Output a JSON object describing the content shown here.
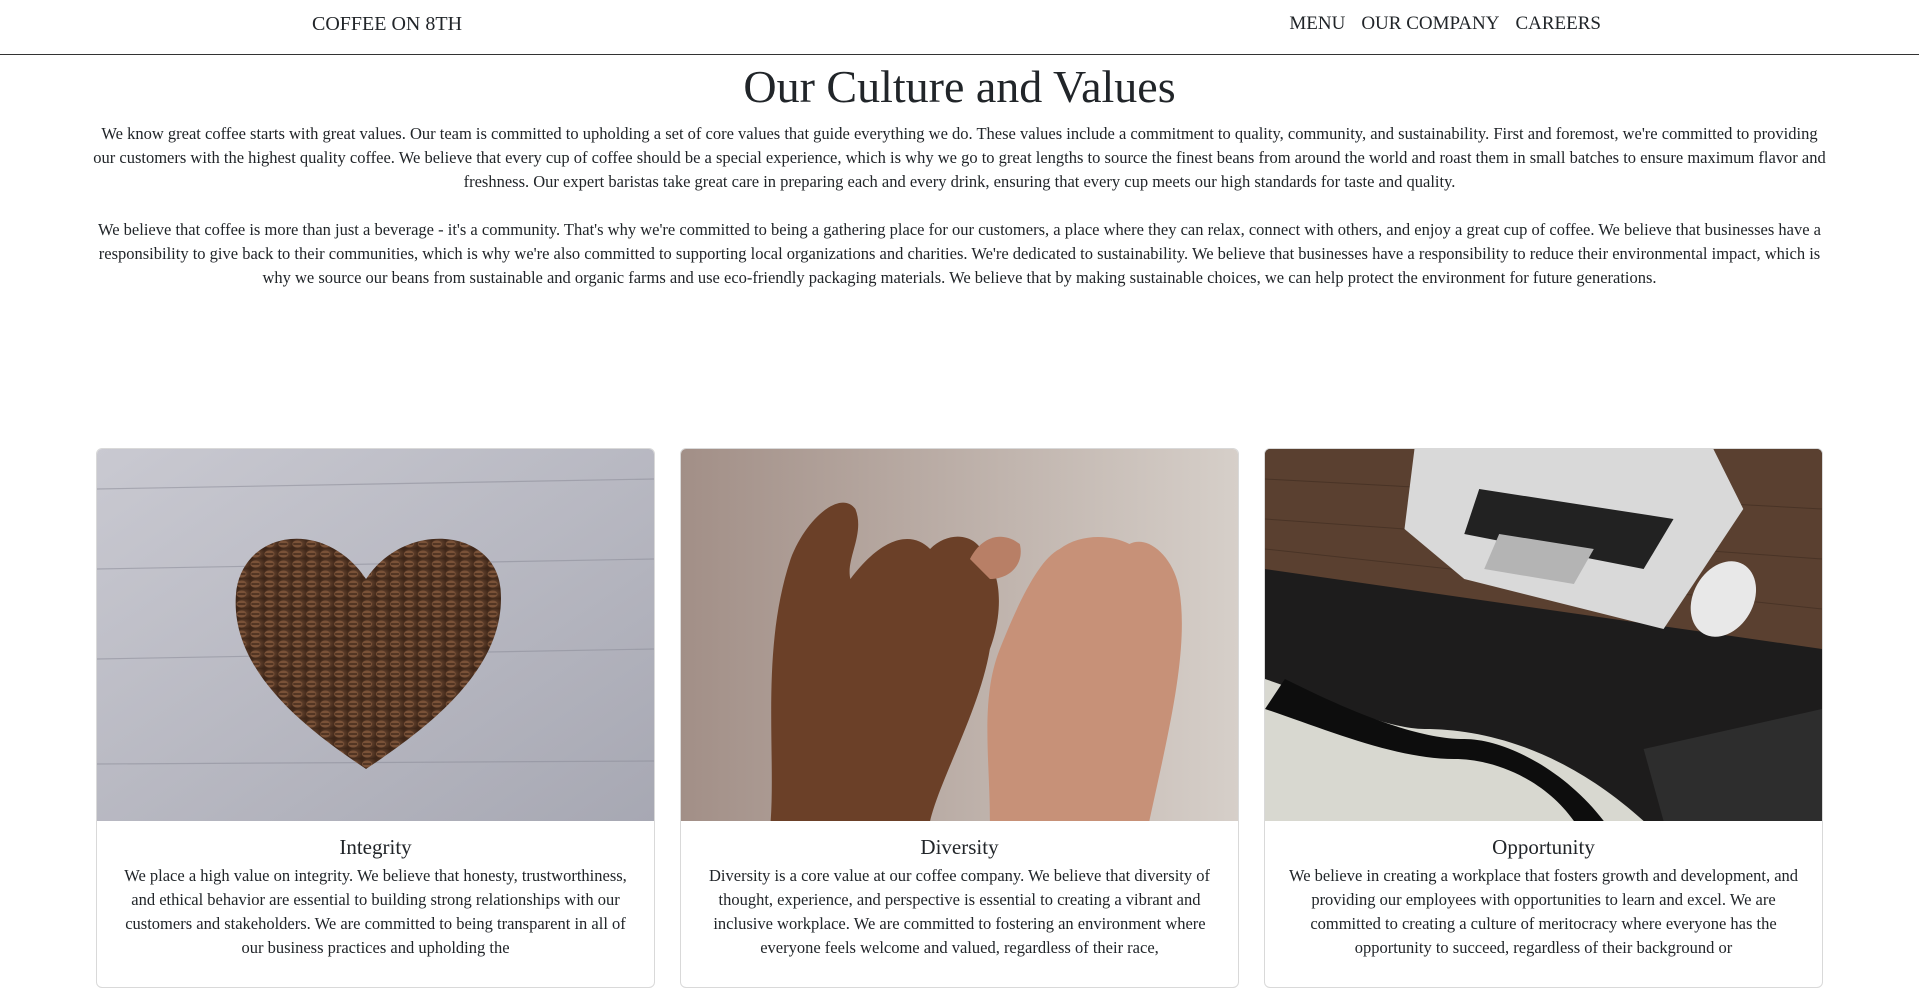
{
  "navbar": {
    "brand": "COFFEE ON 8TH",
    "links": [
      "MENU",
      "OUR COMPANY",
      "CAREERS"
    ]
  },
  "page": {
    "title": "Our Culture and Values",
    "paragraphs": [
      "We know great coffee starts with great values. Our team is committed to upholding a set of core values that guide everything we do. These values include a commitment to quality, community, and sustainability. First and foremost, we're committed to providing our customers with the highest quality coffee. We believe that every cup of coffee should be a special experience, which is why we go to great lengths to source the finest beans from around the world and roast them in small batches to ensure maximum flavor and freshness. Our expert baristas take great care in preparing each and every drink, ensuring that every cup meets our high standards for taste and quality.",
      "We believe that coffee is more than just a beverage - it's a community. That's why we're committed to being a gathering place for our customers, a place where they can relax, connect with others, and enjoy a great cup of coffee. We believe that businesses have a responsibility to give back to their communities, which is why we're also committed to supporting local organizations and charities. We're dedicated to sustainability. We believe that businesses have a responsibility to reduce their environmental impact, which is why we source our beans from sustainable and organic farms and use eco-friendly packaging materials. We believe that by making sustainable choices, we can help protect the environment for future generations."
    ]
  },
  "cards": [
    {
      "title": "Integrity",
      "text": "We place a high value on integrity. We believe that honesty, trustworthiness, and ethical behavior are essential to building strong relationships with our customers and stakeholders. We are committed to being transparent in all of our business practices and upholding the",
      "image": "coffee-bean-heart-image"
    },
    {
      "title": "Diversity",
      "text": "Diversity is a core value at our coffee company. We believe that diversity of thought, experience, and perspective is essential to creating a vibrant and inclusive workplace. We are committed to fostering an environment where everyone feels welcome and valued, regardless of their race,",
      "image": "pinky-promise-hands-image"
    },
    {
      "title": "Opportunity",
      "text": "We believe in creating a workplace that fosters growth and development, and providing our employees with opportunities to learn and excel. We are committed to creating a culture of meritocracy where everyone has the opportunity to succeed, regardless of their background or",
      "image": "laptop-desk-image"
    }
  ]
}
